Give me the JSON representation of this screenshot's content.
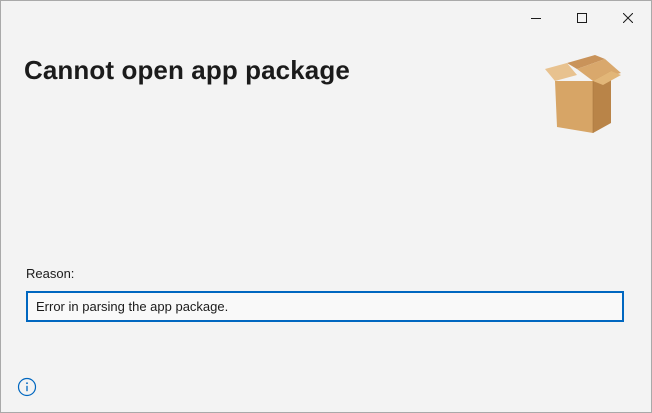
{
  "window": {
    "caption_buttons": {
      "minimize_icon": "minimize-icon",
      "maximize_icon": "maximize-icon",
      "close_icon": "close-icon"
    }
  },
  "dialog": {
    "title": "Cannot open app package",
    "graphic_icon": "package-box-icon",
    "reason_label": "Reason:",
    "reason_value": "Error in parsing the app package.",
    "info_icon": "info-icon"
  },
  "colors": {
    "accent": "#0067c0",
    "background": "#f3f3f3",
    "text": "#1b1b1b"
  }
}
